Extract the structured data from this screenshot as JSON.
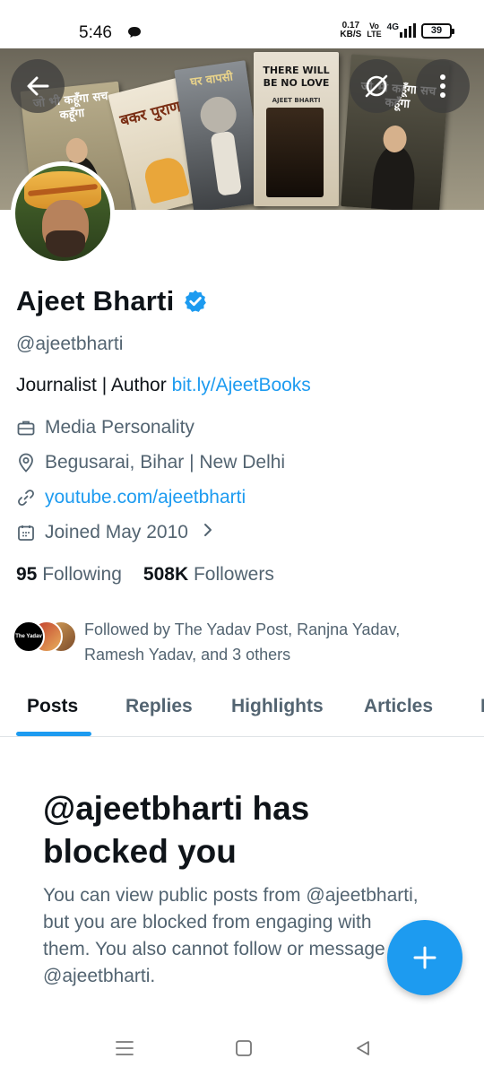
{
  "status_bar": {
    "time": "5:46",
    "net_speed_value": "0.17",
    "net_speed_unit": "KB/S",
    "volte_top": "Vo",
    "volte_bottom": "LTE",
    "network_type": "4G",
    "battery": "39"
  },
  "banner": {
    "book1_title": "जो भी कहूँगा सच कहूँगा",
    "book2_title": "बकर पुराण",
    "book3_title": "घर वापसी",
    "book4_title": "THERE WILL BE NO LOVE",
    "book4_author": "AJEET BHARTI",
    "book5_title": "जो भी कहूँगा सच कहूँगा"
  },
  "profile": {
    "display_name": "Ajeet Bharti",
    "handle": "@ajeetbharti",
    "bio_text": "Journalist | Author ",
    "bio_link": "bit.ly/AjeetBooks",
    "category": "Media Personality",
    "location": "Begusarai, Bihar | New Delhi",
    "website": "youtube.com/ajeetbharti",
    "joined": "Joined May 2010",
    "following_count": "95",
    "following_label": "Following",
    "followers_count": "508K",
    "followers_label": "Followers",
    "followed_by_text": "Followed by The Yadav Post, Ranjna Yadav, Ramesh Yadav, and 3 others",
    "followed_by_avatar1_text": "The Yadav Post"
  },
  "tabs": [
    {
      "label": "Posts",
      "active": true
    },
    {
      "label": "Replies",
      "active": false
    },
    {
      "label": "Highlights",
      "active": false
    },
    {
      "label": "Articles",
      "active": false
    },
    {
      "label": "M",
      "active": false
    }
  ],
  "blocked": {
    "title": "@ajeetbharti has blocked you",
    "body": "You can view public posts from @ajeetbharti, but you are blocked from engaging with them. You also cannot follow or message @ajeetbharti."
  },
  "colors": {
    "accent": "#1d9bf0",
    "text_primary": "#0f1419",
    "text_secondary": "#536471"
  },
  "icons": {
    "back": "arrow-left-icon",
    "grok": "grok-icon",
    "more": "more-vertical-icon",
    "verified": "verified-badge-icon",
    "category": "briefcase-icon",
    "location": "location-pin-icon",
    "website": "link-icon",
    "joined": "calendar-icon",
    "joined_more": "chevron-right-icon",
    "compose": "plus-icon",
    "nav_recents": "menu-lines-icon",
    "nav_home": "square-icon",
    "nav_back": "triangle-back-icon"
  }
}
